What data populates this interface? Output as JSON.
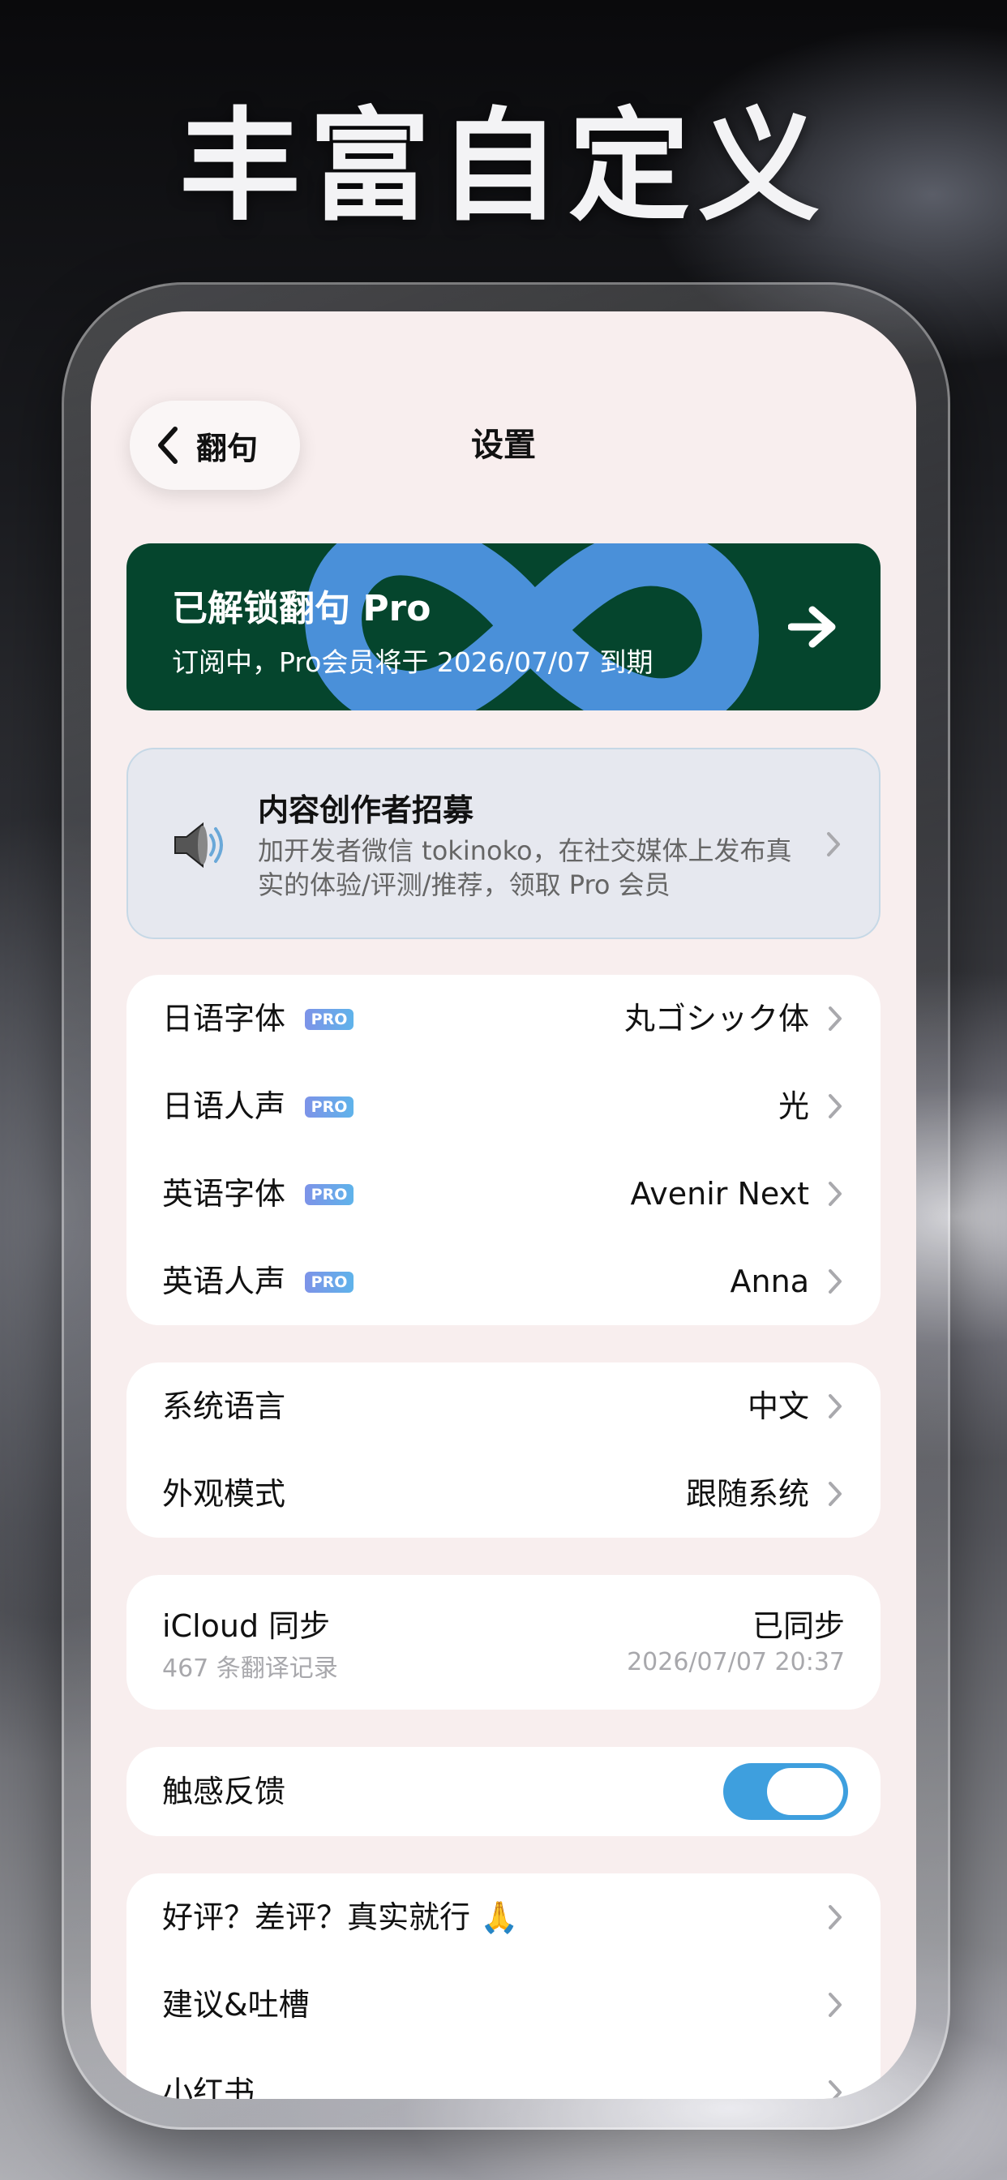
{
  "headline": "丰富自定义",
  "nav": {
    "back_label": "翻句",
    "title": "设置"
  },
  "pro_banner": {
    "title": "已解锁翻句 Pro",
    "subtitle": "订阅中，Pro会员将于 2026/07/07 到期",
    "accent": "#4a90d9",
    "background": "#05452d"
  },
  "creator_card": {
    "title": "内容创作者招募",
    "description": "加开发者微信 tokinoko，在社交媒体上发布真实的体验/评测/推荐，领取 Pro 会员",
    "icon": "speaker-icon"
  },
  "pro_badge_label": "PRO",
  "voice_group": [
    {
      "label": "日语字体",
      "value": "丸ゴシック体"
    },
    {
      "label": "日语人声",
      "value": "光"
    },
    {
      "label": "英语字体",
      "value": "Avenir Next"
    },
    {
      "label": "英语人声",
      "value": "Anna"
    }
  ],
  "system_group": [
    {
      "label": "系统语言",
      "value": "中文"
    },
    {
      "label": "外观模式",
      "value": "跟随系统"
    }
  ],
  "icloud": {
    "label": "iCloud 同步",
    "status": "已同步",
    "records": "467 条翻译记录",
    "timestamp": "2026/07/07 20:37"
  },
  "haptics": {
    "label": "触感反馈",
    "enabled": true,
    "accent": "#3e9fde"
  },
  "feedback_group": [
    {
      "label": "好评？差评？真实就行 🙏"
    },
    {
      "label": "建议&吐槽"
    },
    {
      "label": "小红书"
    }
  ]
}
